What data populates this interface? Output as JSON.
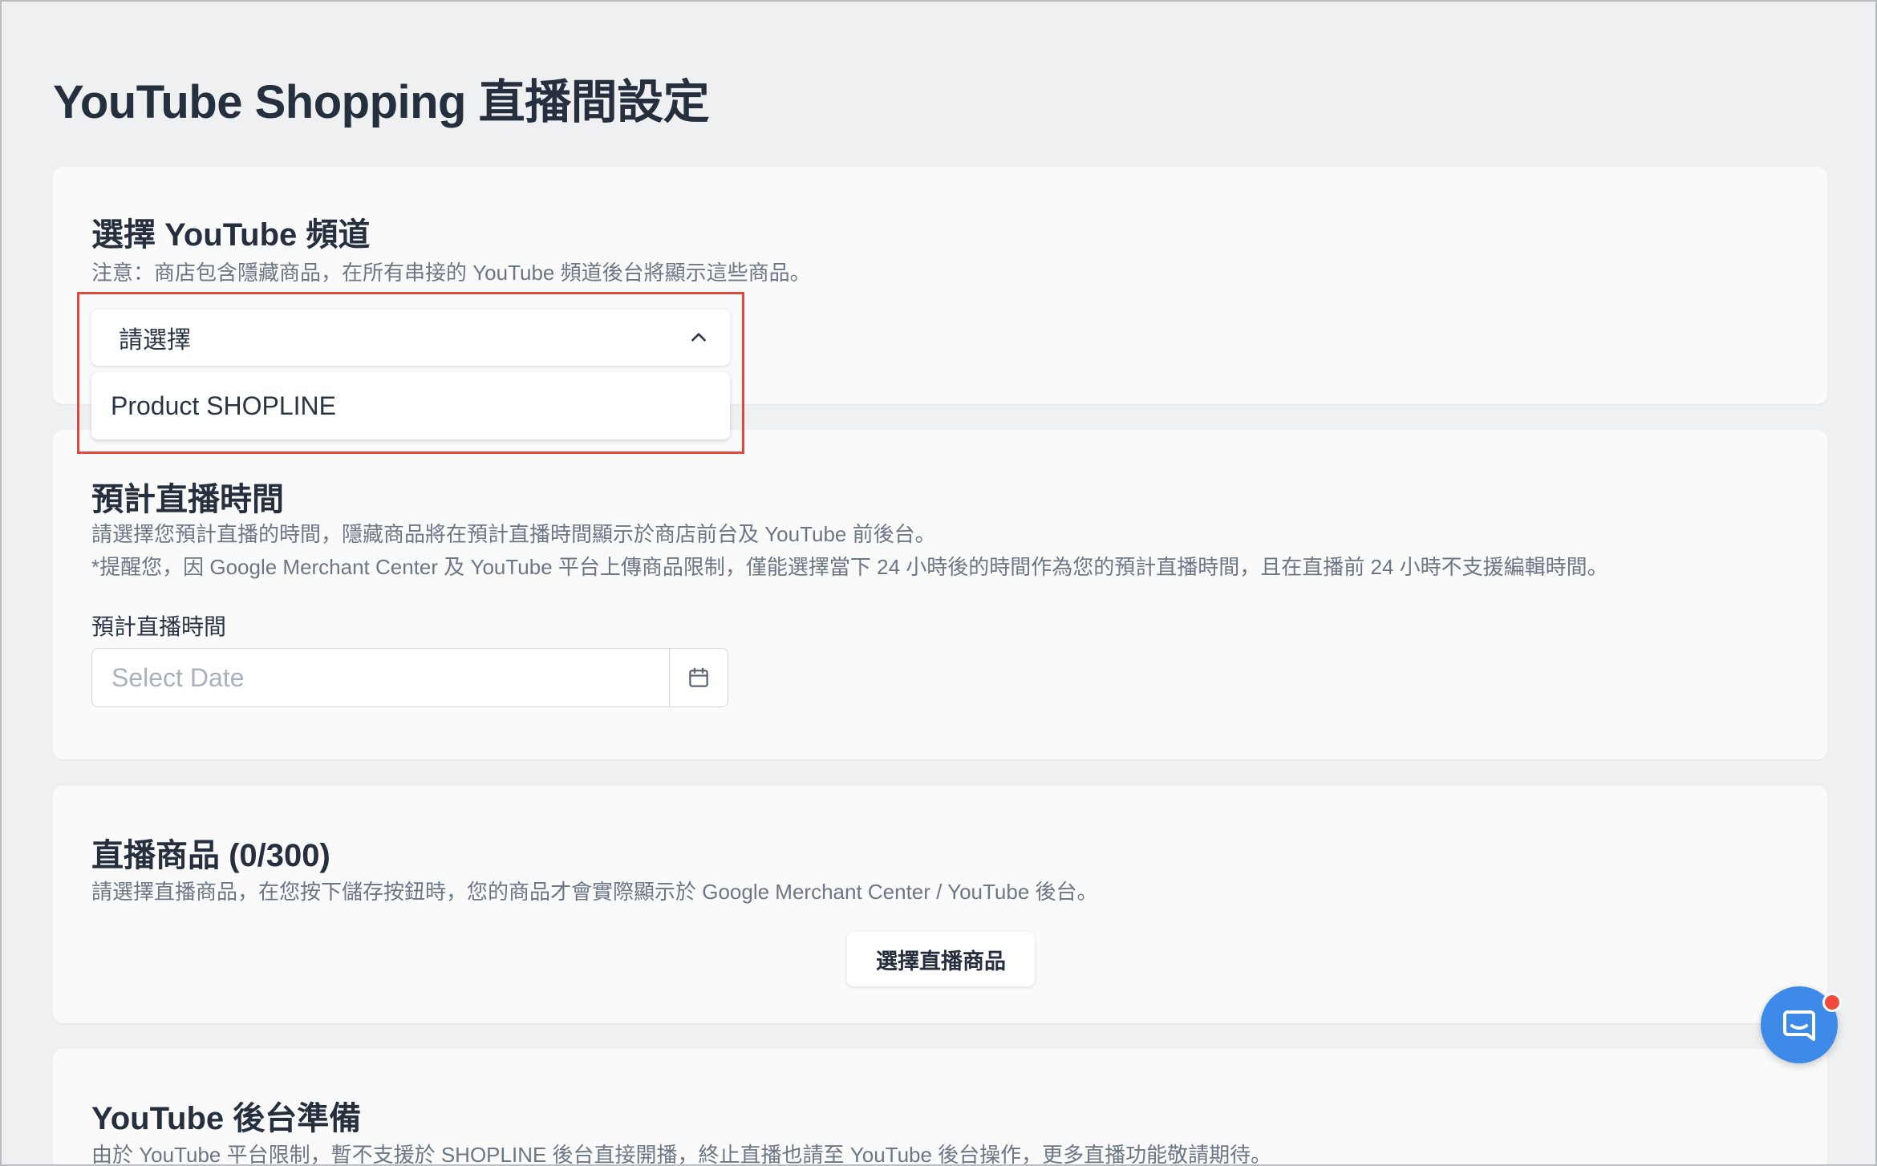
{
  "page": {
    "title": "YouTube Shopping 直播間設定"
  },
  "channel_section": {
    "title": "選擇 YouTube 頻道",
    "note": "注意：商店包含隱藏商品，在所有串接的 YouTube 頻道後台將顯示這些商品。",
    "select_placeholder": "請選擇",
    "dropdown_open": true,
    "options": [
      "Product SHOPLINE"
    ],
    "highlight_color": "#e1473b"
  },
  "time_section": {
    "title": "預計直播時間",
    "desc_line1": "請選擇您預計直播的時間，隱藏商品將在預計直播時間顯示於商店前台及 YouTube 前後台。",
    "desc_line2": "*提醒您，因 Google Merchant Center 及 YouTube 平台上傳商品限制，僅能選擇當下 24 小時後的時間作為您的預計直播時間，且在直播前 24 小時不支援編輯時間。",
    "field_label": "預計直播時間",
    "date_value": "",
    "date_placeholder": "Select Date",
    "calendar_icon": "calendar-icon"
  },
  "products_section": {
    "title": "直播商品 (0/300)",
    "desc": "請選擇直播商品，在您按下儲存按鈕時，您的商品才會實際顯示於 Google Merchant Center / YouTube 後台。",
    "button_label": "選擇直播商品"
  },
  "backend_section": {
    "title": "YouTube 後台準備",
    "desc": "由於 YouTube 平台限制，暫不支援於 SHOPLINE 後台直接開播，終止直播也請至 YouTube 後台操作，更多直播功能敬請期待。"
  },
  "chat": {
    "icon": "chat-bubble-icon",
    "accent_color": "#3d8ae8",
    "notification_color": "#ef4a3c"
  }
}
